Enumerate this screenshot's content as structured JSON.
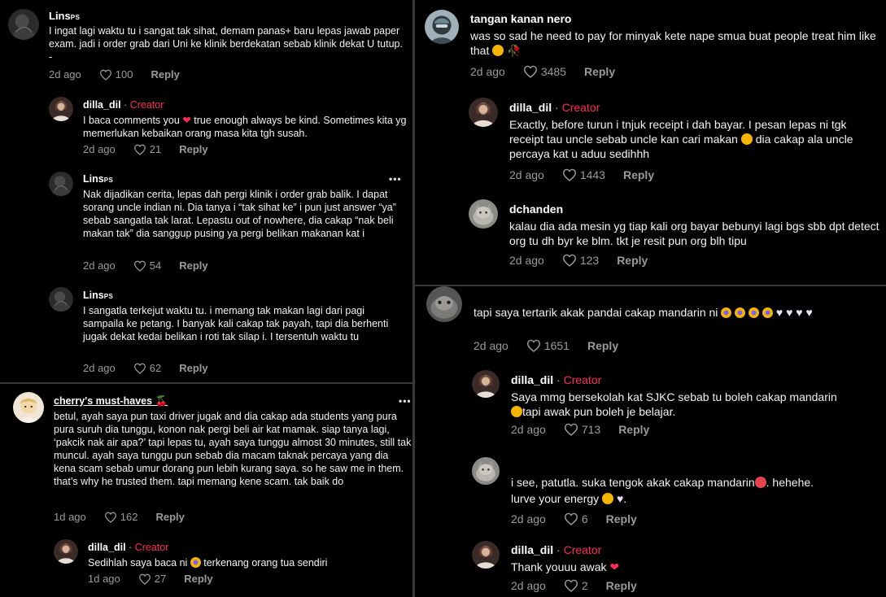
{
  "panel_top_left": {
    "comments": [
      {
        "user": "Lins",
        "user_suffix": "PS",
        "text": "I ingat lagi waktu tu i sangat tak sihat, demam panas+ baru lepas jawab paper exam. jadi i order grab dari Uni ke klinik berdekatan sebab klinik dekat U tutup. -",
        "time": "2d ago",
        "likes": "100",
        "reply": "Reply"
      },
      {
        "user": "dilla_dil",
        "badge": "Creator",
        "text_a": "I baca comments you ",
        "text_b": " true enough always be kind. Sometimes kita yg memerlukan kebaikan orang masa kita tgh susah.",
        "time": "2d ago",
        "likes": "21",
        "reply": "Reply"
      },
      {
        "user": "Lins",
        "user_suffix": "PS",
        "text": "Nak dijadikan cerita, lepas dah pergi klinik i order grab balik. I dapat sorang uncle indian ni. Dia tanya i “tak sihat ke” i pun just answer “ya” sebab sangatla tak larat. Lepastu out of nowhere, dia cakap “nak beli makan tak” dia sanggup pusing ya pergi belikan makanan kat i",
        "time": "2d ago",
        "likes": "54",
        "reply": "Reply",
        "more": "•••"
      },
      {
        "user": "Lins",
        "user_suffix": "PS",
        "text": "I sangatla terkejut waktu tu. i memang tak makan lagi dari pagi sampaila ke petang. I banyak kali cakap tak payah, tapi dia berhenti jugak dekat kedai belikan i roti tak silap i. I tersentuh waktu tu",
        "time": "2d ago",
        "likes": "62",
        "reply": "Reply"
      }
    ]
  },
  "panel_bottom_left": {
    "comments": [
      {
        "user": "cherry's must-haves",
        "text": "betul, ayah saya pun taxi driver jugak and dia cakap ada students yang pura pura suruh dia tunggu, konon nak pergi beli air kat mamak. siap tanya lagi, ‘pakcik nak air apa?’ tapi lepas tu, ayah saya tunggu almost 30 minutes, still tak muncul. ayah saya tunggu pun sebab dia macam taknak percaya yang dia kena scam sebab umur dorang pun lebih kurang saya. so he saw me in them. that’s why he trusted them. tapi memang kene scam. tak baik do",
        "time": "1d ago",
        "likes": "162",
        "reply": "Reply",
        "more": "•••"
      },
      {
        "user": "dilla_dil",
        "badge": "Creator",
        "text_a": "Sedihlah saya baca ni ",
        "text_b": " terkenang orang tua sendiri",
        "time": "1d ago",
        "likes": "27",
        "reply": "Reply"
      }
    ]
  },
  "panel_top_right": {
    "comments": [
      {
        "user": "tangan kanan nero",
        "text": "was so sad he need to pay for minyak kete nape smua buat people treat him like that",
        "time": "2d ago",
        "likes": "3485",
        "reply": "Reply"
      },
      {
        "user": "dilla_dil",
        "badge": "Creator",
        "text_a": "Exactly, before turun i tnjuk receipt i dah bayar. I pesan lepas ni tgk receipt tau uncle sebab uncle kan cari makan ",
        "text_b": " dia cakap ala uncle percaya kat u aduu sedihhh",
        "time": "2d ago",
        "likes": "1443",
        "reply": "Reply"
      },
      {
        "user": "dchanden",
        "text": "kalau dia ada mesin yg tiap kali org bayar bebunyi lagi bgs sbb dpt detect org tu dh byr ke blm. tkt je resit pun org blh tipu",
        "time": "2d ago",
        "likes": "123",
        "reply": "Reply"
      }
    ]
  },
  "panel_bottom_right": {
    "comments": [
      {
        "user": "",
        "text": "tapi saya tertarik akak pandai cakap mandarin ni",
        "time": "2d ago",
        "likes": "1651",
        "reply": "Reply"
      },
      {
        "user": "dilla_dil",
        "badge": "Creator",
        "text_a": "Saya mmg bersekolah kat SJKC sebab tu boleh cakap mandarin",
        "text_b": "tapi awak pun boleh je belajar.",
        "time": "2d ago",
        "likes": "713",
        "reply": "Reply"
      },
      {
        "user": "",
        "text_a": "i see, patutla. suka tengok akak cakap mandarin",
        "text_b": ". hehehe.",
        "text_c": "lurve your energy",
        "text_d": ".",
        "time": "2d ago",
        "likes": "6",
        "reply": "Reply"
      },
      {
        "user": "dilla_dil",
        "badge": "Creator",
        "text": "Thank youuu awak",
        "time": "2d ago",
        "likes": "2",
        "reply": "Reply"
      }
    ]
  },
  "colors": {
    "creator": "#fe2c55",
    "meta": "#9a9a9a",
    "background": "#000000",
    "divider": "#3a3a3a"
  },
  "icons": [
    "heart-outline-icon",
    "more-dots-icon",
    "avatar"
  ]
}
